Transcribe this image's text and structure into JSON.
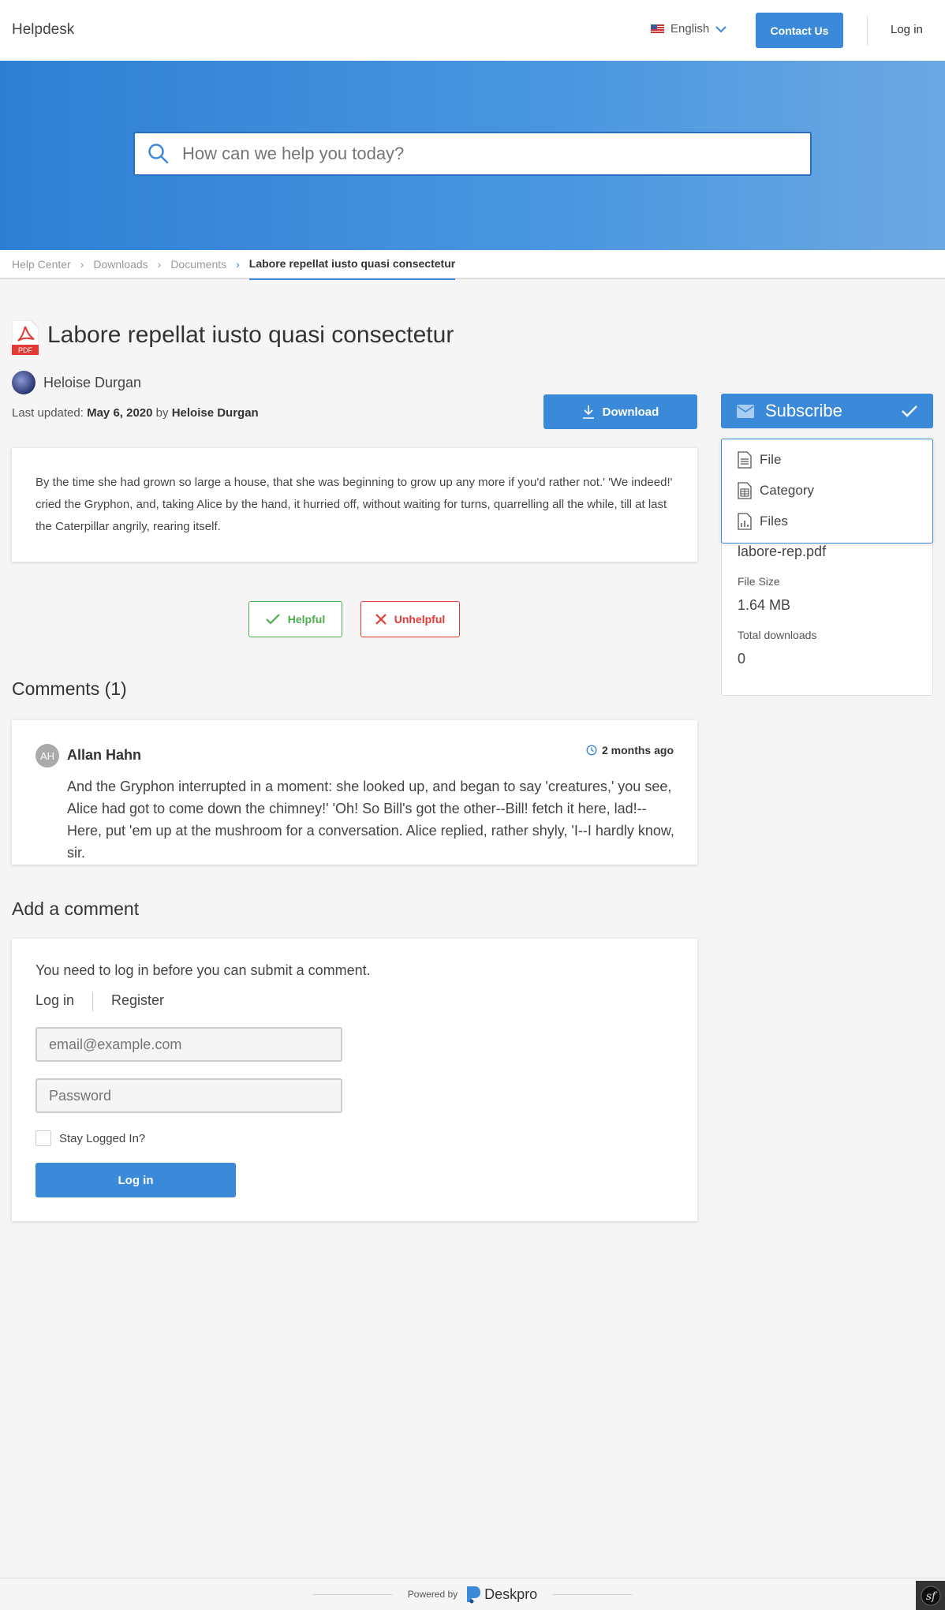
{
  "header": {
    "brand": "Helpdesk",
    "language": "English",
    "contact_label": "Contact Us",
    "login_label": "Log in"
  },
  "search": {
    "placeholder": "How can we help you today?"
  },
  "breadcrumb": {
    "items": [
      "Help Center",
      "Downloads",
      "Documents"
    ],
    "current": "Labore repellat iusto quasi consectetur"
  },
  "article": {
    "file_icon_label": "PDF",
    "title": "Labore repellat iusto quasi consectetur",
    "author": "Heloise Durgan",
    "updated_prefix": "Last updated:",
    "updated_date": "May 6, 2020",
    "updated_by_word": "by",
    "updated_by": "Heloise Durgan",
    "download_label": "Download",
    "body": "By the time she had grown so large a house, that she was beginning to grow up any more if you'd rather not.' 'We indeed!' cried the Gryphon, and, taking Alice by the hand, it hurried off, without waiting for turns, quarrelling all the while, till at last the Caterpillar angrily, rearing itself.",
    "helpful_label": "Helpful",
    "unhelpful_label": "Unhelpful"
  },
  "comments": {
    "heading": "Comments (1)",
    "items": [
      {
        "initials": "AH",
        "name": "Allan Hahn",
        "time": "2 months ago",
        "text": "And the Gryphon interrupted in a moment: she looked up, and began to say 'creatures,' you see, Alice had got to come down the chimney!' 'Oh! So Bill's got the other--Bill! fetch it here, lad!--Here, put 'em up at the mushroom for a conversation. Alice replied, rather shyly, 'I--I hardly know, sir."
      }
    ]
  },
  "add_comment": {
    "heading": "Add a comment",
    "need_login": "You need to log in before you can submit a comment.",
    "tab_login": "Log in",
    "tab_register": "Register",
    "email_placeholder": "email@example.com",
    "password_placeholder": "Password",
    "stay_logged_in": "Stay Logged In?",
    "login_button": "Log in"
  },
  "sidebar": {
    "subscribe_label": "Subscribe",
    "dropdown_items": [
      "File",
      "Category",
      "Files"
    ],
    "file_name": "labore-rep.pdf",
    "file_size_label": "File Size",
    "file_size": "1.64 MB",
    "downloads_label": "Total downloads",
    "downloads": "0"
  },
  "footer": {
    "powered_by": "Powered by",
    "brand": "Deskpro"
  },
  "colors": {
    "primary": "#3b8ad9",
    "helpful": "#4caf50",
    "unhelpful": "#e53935"
  }
}
